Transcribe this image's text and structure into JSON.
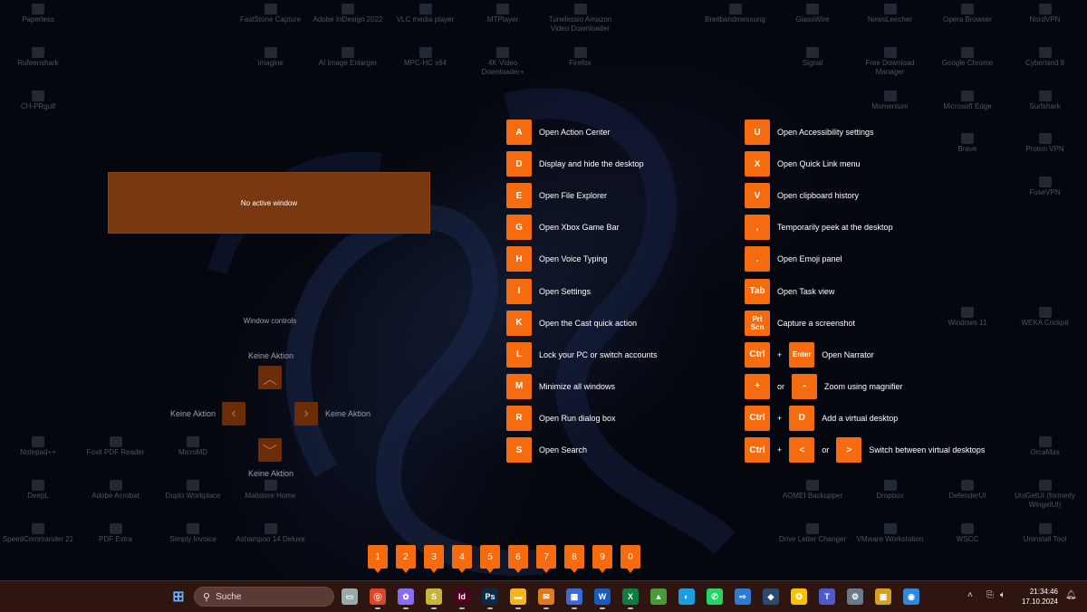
{
  "desktop_icons": [
    {
      "label": "Paperless",
      "col": 0,
      "row": 0
    },
    {
      "label": "Rufeenshark",
      "col": 0,
      "row": 1
    },
    {
      "label": "CH-PRgulf",
      "col": 0,
      "row": 2
    },
    {
      "label": "FastStone Capture",
      "col": 3,
      "row": 0
    },
    {
      "label": "Adobe InDesign 2022",
      "col": 4,
      "row": 0
    },
    {
      "label": "VLC media player",
      "col": 5,
      "row": 0
    },
    {
      "label": "MTPlayer",
      "col": 6,
      "row": 0
    },
    {
      "label": "Tunelessio Amazon Video Downloader",
      "col": 7,
      "row": 0
    },
    {
      "label": "Breitbandmessung",
      "col": 9,
      "row": 0
    },
    {
      "label": "GlassWire",
      "col": 10,
      "row": 0
    },
    {
      "label": "NewsLeecher",
      "col": 11,
      "row": 0
    },
    {
      "label": "Opera Browser",
      "col": 12,
      "row": 0
    },
    {
      "label": "NordVPN",
      "col": 13,
      "row": 0
    },
    {
      "label": "Imagine",
      "col": 3,
      "row": 1
    },
    {
      "label": "AI Image Enlarger",
      "col": 4,
      "row": 1
    },
    {
      "label": "MPC-HC x64",
      "col": 5,
      "row": 1
    },
    {
      "label": "4K Video Downloader+",
      "col": 6,
      "row": 1
    },
    {
      "label": "Firefox",
      "col": 7,
      "row": 1
    },
    {
      "label": "Signal",
      "col": 10,
      "row": 1
    },
    {
      "label": "Free Download Manager",
      "col": 11,
      "row": 1
    },
    {
      "label": "Google Chrome",
      "col": 12,
      "row": 1
    },
    {
      "label": "Cyberland 8",
      "col": 13,
      "row": 1
    },
    {
      "label": "Momentum",
      "col": 11,
      "row": 2
    },
    {
      "label": "Microsoft Edge",
      "col": 12,
      "row": 2
    },
    {
      "label": "Surfshark",
      "col": 13,
      "row": 2
    },
    {
      "label": "Brave",
      "col": 12,
      "row": 3
    },
    {
      "label": "Proton VPN",
      "col": 13,
      "row": 3
    },
    {
      "label": "FuseVPN",
      "col": 13,
      "row": 4
    },
    {
      "label": "Windows 11",
      "col": 12,
      "row": 7
    },
    {
      "label": "WEKA Cockpit",
      "col": 13,
      "row": 7
    },
    {
      "label": "Notepad++",
      "col": 0,
      "row": 10
    },
    {
      "label": "Foxit PDF Reader",
      "col": 1,
      "row": 10
    },
    {
      "label": "MicroMD",
      "col": 2,
      "row": 10
    },
    {
      "label": "OrcaMax",
      "col": 13,
      "row": 10
    },
    {
      "label": "DeepL",
      "col": 0,
      "row": 11
    },
    {
      "label": "Adobe Acrobat",
      "col": 1,
      "row": 11
    },
    {
      "label": "Duplo Workplace",
      "col": 2,
      "row": 11
    },
    {
      "label": "Mailstore Home",
      "col": 3,
      "row": 11
    },
    {
      "label": "AOMEI Backupper",
      "col": 10,
      "row": 11
    },
    {
      "label": "Dropbox",
      "col": 11,
      "row": 11
    },
    {
      "label": "DefenderUI",
      "col": 12,
      "row": 11
    },
    {
      "label": "UniGetUI (formerly WingetUI)",
      "col": 13,
      "row": 11
    },
    {
      "label": "SpeedCommander 21",
      "col": 0,
      "row": 12
    },
    {
      "label": "PDF Extra",
      "col": 1,
      "row": 12
    },
    {
      "label": "Simply Invoice",
      "col": 2,
      "row": 12
    },
    {
      "label": "Ashampoo 14 Deluxe",
      "col": 3,
      "row": 12
    },
    {
      "label": "Drive Letter Changer",
      "col": 10,
      "row": 12
    },
    {
      "label": "VMware Workstation",
      "col": 11,
      "row": 12
    },
    {
      "label": "WSCC",
      "col": 12,
      "row": 12
    },
    {
      "label": "Uninstall Tool",
      "col": 13,
      "row": 12
    }
  ],
  "active_window": {
    "text": "No active window"
  },
  "window_controls": {
    "title": "Window controls",
    "up": "Keine Aktion",
    "left": "Keine Aktion",
    "right": "Keine Aktion",
    "down": "Keine Aktion"
  },
  "shortcuts_left": [
    {
      "key": "A",
      "desc": "Open Action Center"
    },
    {
      "key": "D",
      "desc": "Display and hide the desktop"
    },
    {
      "key": "E",
      "desc": "Open File Explorer"
    },
    {
      "key": "G",
      "desc": "Open Xbox Game Bar"
    },
    {
      "key": "H",
      "desc": "Open Voice Typing"
    },
    {
      "key": "I",
      "desc": "Open Settings"
    },
    {
      "key": "K",
      "desc": "Open the Cast quick action"
    },
    {
      "key": "L",
      "desc": "Lock your PC or switch accounts"
    },
    {
      "key": "M",
      "desc": "Minimize all windows"
    },
    {
      "key": "R",
      "desc": "Open Run dialog box"
    },
    {
      "key": "S",
      "desc": "Open Search"
    }
  ],
  "shortcuts_right": [
    {
      "keys": [
        "U"
      ],
      "seps": [],
      "desc": "Open Accessibility settings"
    },
    {
      "keys": [
        "X"
      ],
      "seps": [],
      "desc": "Open Quick Link menu"
    },
    {
      "keys": [
        "V"
      ],
      "seps": [],
      "desc": "Open clipboard history"
    },
    {
      "keys": [
        ","
      ],
      "seps": [],
      "desc": "Temporarily peek at the desktop"
    },
    {
      "keys": [
        "."
      ],
      "seps": [],
      "desc": "Open Emoji panel"
    },
    {
      "keys": [
        "Tab"
      ],
      "seps": [],
      "desc": "Open Task view"
    },
    {
      "keys": [
        "Prt Scn"
      ],
      "seps": [],
      "desc": "Capture a screenshot"
    },
    {
      "keys": [
        "Ctrl",
        "Enter"
      ],
      "seps": [
        "+"
      ],
      "desc": "Open Narrator"
    },
    {
      "keys": [
        "+",
        "-"
      ],
      "seps": [
        "or"
      ],
      "desc": "Zoom using magnifier"
    },
    {
      "keys": [
        "Ctrl",
        "D"
      ],
      "seps": [
        "+"
      ],
      "desc": "Add a virtual desktop"
    },
    {
      "keys": [
        "Ctrl",
        "<",
        ">"
      ],
      "seps": [
        "+",
        "or"
      ],
      "desc": "Switch between virtual desktops"
    }
  ],
  "number_badges": [
    "1",
    "2",
    "3",
    "4",
    "5",
    "6",
    "7",
    "8",
    "9",
    "0"
  ],
  "taskbar": {
    "search_placeholder": "Suche",
    "apps": [
      {
        "name": "task-view-icon",
        "glyph": "▭",
        "color": "#9aa"
      },
      {
        "name": "1password-icon",
        "glyph": "⓪",
        "color": "#d9462b"
      },
      {
        "name": "copilot-icon",
        "glyph": "✿",
        "color": "#8a6cf0"
      },
      {
        "name": "s-app-icon",
        "glyph": "S",
        "color": "#c9b43a"
      },
      {
        "name": "indesign-icon",
        "glyph": "Id",
        "color": "#49021f"
      },
      {
        "name": "photoshop-icon",
        "glyph": "Ps",
        "color": "#0a2a4a"
      },
      {
        "name": "file-explorer-icon",
        "glyph": "▬",
        "color": "#f2b51d"
      },
      {
        "name": "mail-app-icon",
        "glyph": "✉",
        "color": "#e07a1a"
      },
      {
        "name": "microsoft-store-icon",
        "glyph": "▦",
        "color": "#3a6ad6"
      },
      {
        "name": "word-icon",
        "glyph": "W",
        "color": "#185abd"
      },
      {
        "name": "excel-icon",
        "glyph": "X",
        "color": "#107c41"
      },
      {
        "name": "image-viewer-icon",
        "glyph": "▲",
        "color": "#4a9a3a"
      },
      {
        "name": "edge-icon",
        "glyph": "◐",
        "color": "#1b9de2"
      },
      {
        "name": "whatsapp-icon",
        "glyph": "✆",
        "color": "#25d366"
      },
      {
        "name": "remote-desktop-icon",
        "glyph": "⇨",
        "color": "#2a7ad6"
      },
      {
        "name": "app-cube-icon",
        "glyph": "◆",
        "color": "#2b4a70"
      },
      {
        "name": "norton-icon",
        "glyph": "✪",
        "color": "#f5c400"
      },
      {
        "name": "teams-icon",
        "glyph": "T",
        "color": "#5059c9"
      },
      {
        "name": "settings-icon",
        "glyph": "⚙",
        "color": "#6a7a8a"
      },
      {
        "name": "control-panel-icon",
        "glyph": "▣",
        "color": "#d6a020"
      },
      {
        "name": "browser-app-icon",
        "glyph": "◉",
        "color": "#2a8ae0"
      }
    ],
    "time": "21:34:46",
    "date": "17.10.2024"
  },
  "colors": {
    "accent": "#f46b10",
    "taskbar": "#2e1510"
  }
}
